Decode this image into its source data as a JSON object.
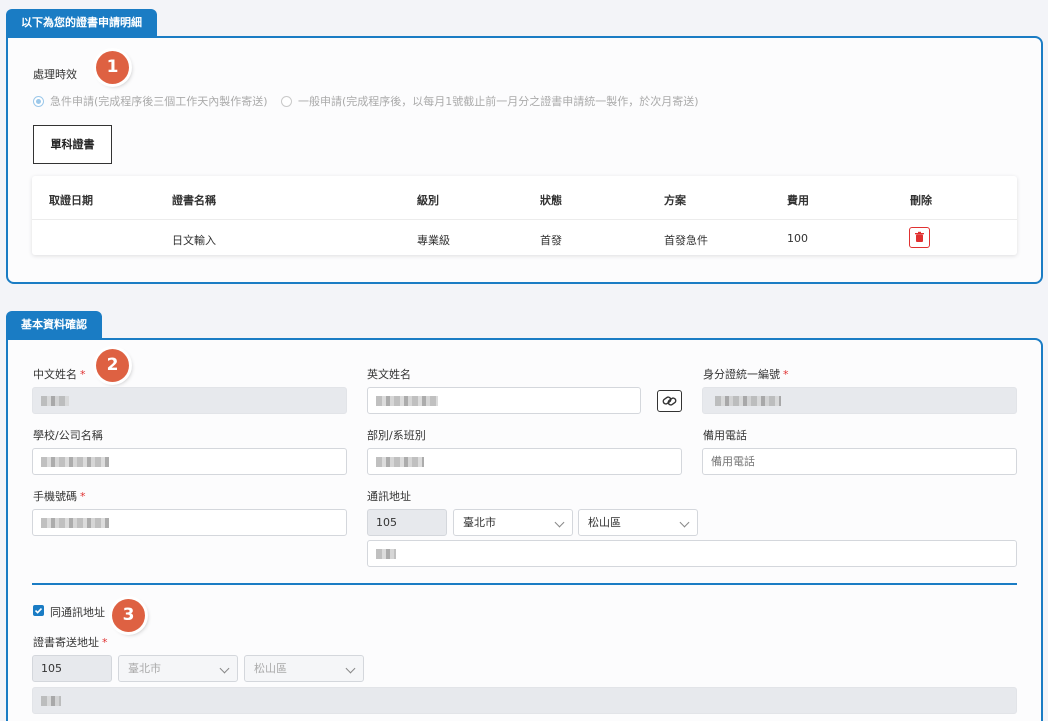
{
  "section1": {
    "tab": "以下為您的證書申請明細",
    "badge": "1",
    "processing_label": "處理時效",
    "option_urgent": "急件申請(完成程序後三個工作天內製作寄送)",
    "option_normal": "一般申請(完成程序後，以每月1號截止前一月分之證書申請統一製作，於次月寄送)",
    "single_cert_button": "單科證書",
    "table": {
      "headers": [
        "取證日期",
        "證書名稱",
        "級別",
        "狀態",
        "方案",
        "費用",
        "刪除"
      ],
      "rows": [
        {
          "date": "",
          "name": "日文輸入",
          "level": "專業級",
          "status": "首發",
          "plan": "首發急件",
          "fee": "100"
        }
      ]
    }
  },
  "section2": {
    "tab": "基本資料確認",
    "badge": "2",
    "chinese_name_label": "中文姓名",
    "english_name_label": "英文姓名",
    "id_label": "身分證統一編號",
    "school_label": "學校/公司名稱",
    "dept_label": "部別/系班別",
    "backup_phone_label": "備用電話",
    "backup_phone_placeholder": "備用電話",
    "mobile_label": "手機號碼",
    "address_label": "通訊地址",
    "zip": "105",
    "city": "臺北市",
    "district": "松山區",
    "badge3": "3",
    "same_address_label": "同通訊地址",
    "cert_address_label": "證書寄送地址",
    "cert_zip": "105",
    "cert_city": "臺北市",
    "cert_district": "松山區"
  }
}
